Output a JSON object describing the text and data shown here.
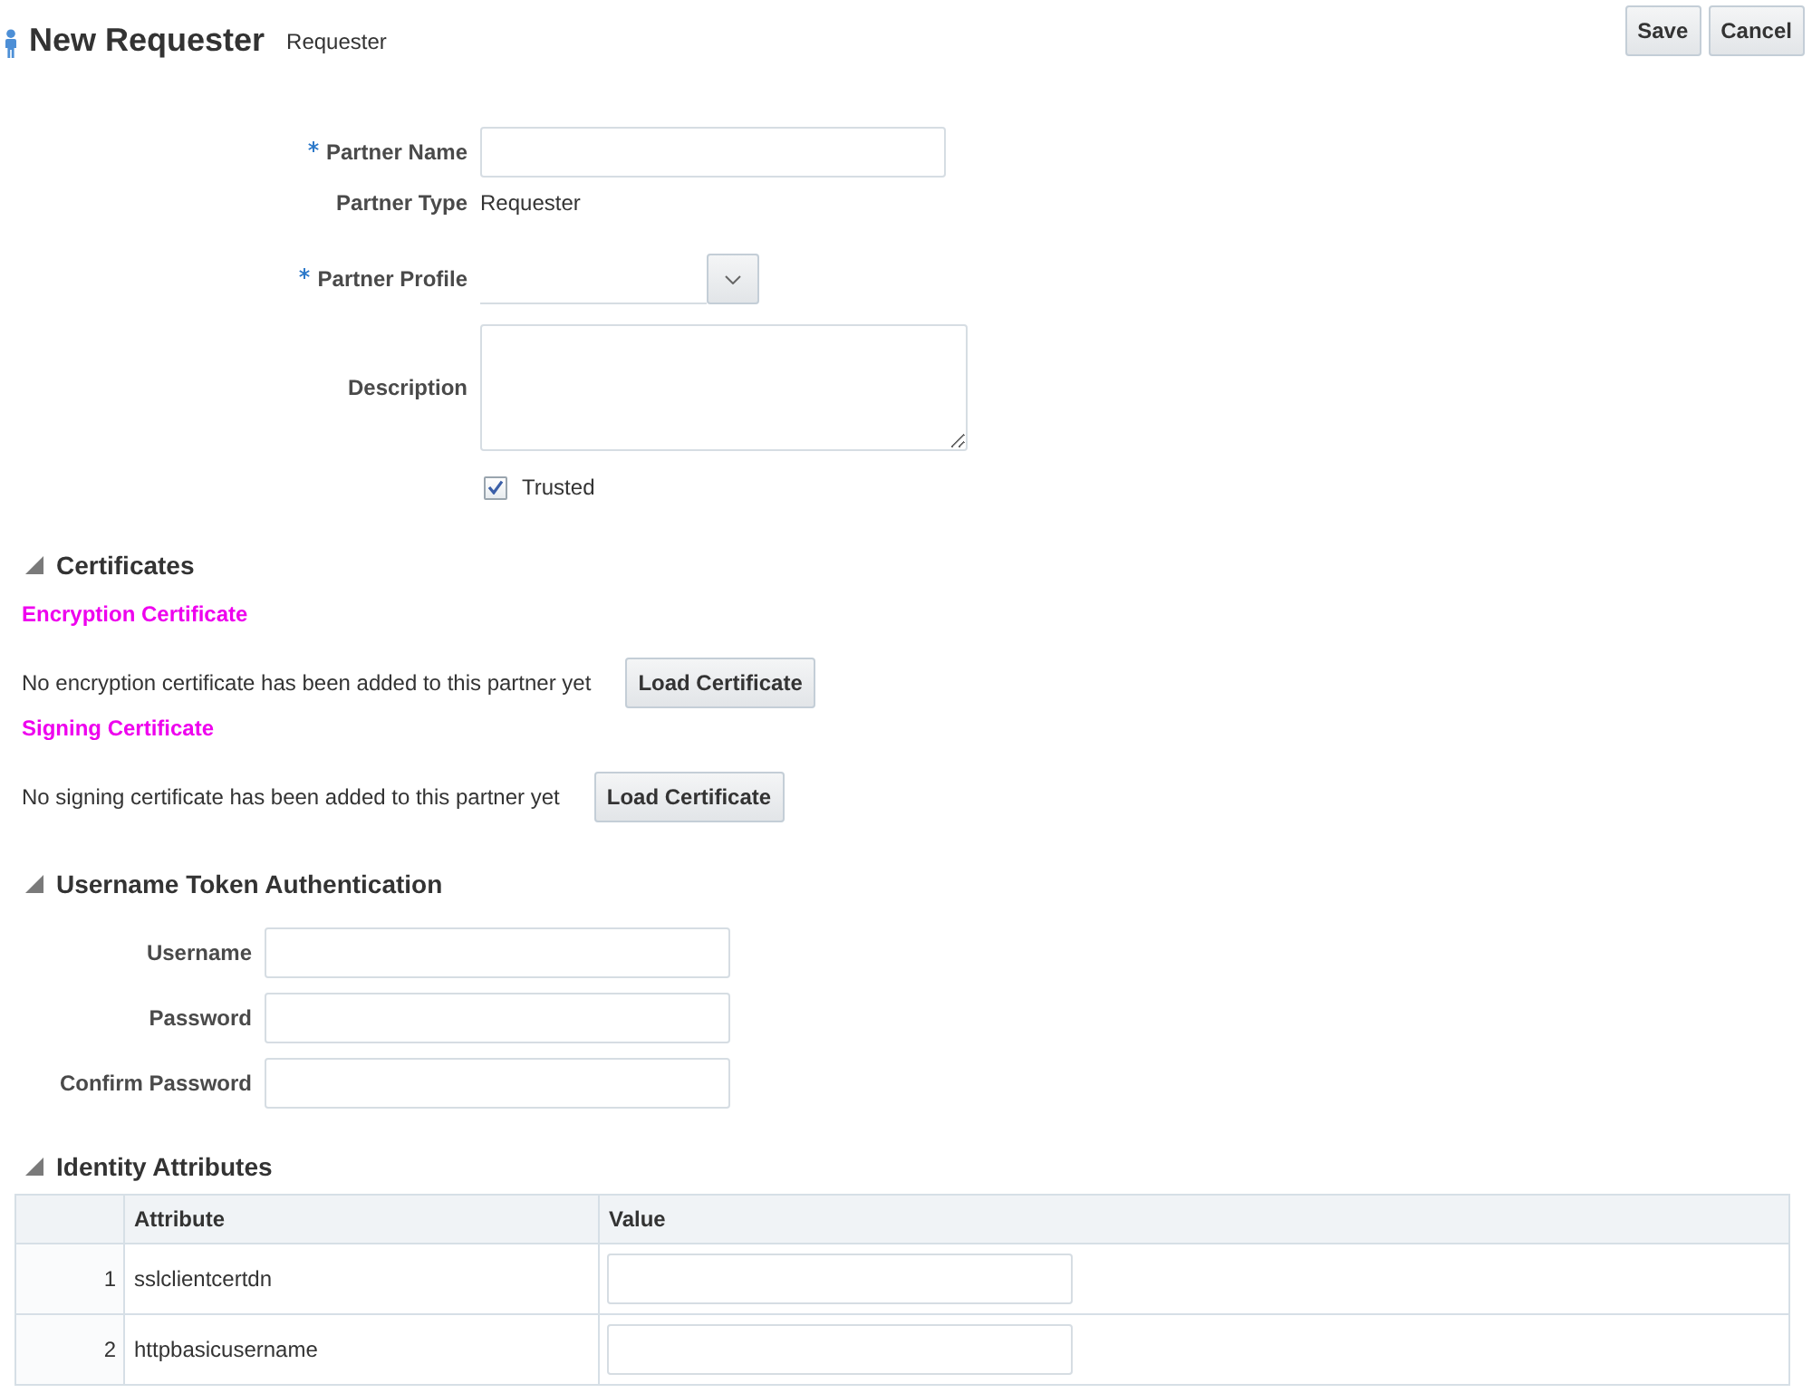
{
  "header": {
    "title": "New Requester",
    "subtitle": "Requester",
    "actions": [
      "Save",
      "Cancel"
    ]
  },
  "general": {
    "fields": [
      {
        "kind": "text",
        "label": "Partner Name",
        "required": true
      },
      {
        "kind": "static",
        "label": "Partner Type",
        "value": "Requester",
        "required": false
      },
      {
        "kind": "select",
        "label": "Partner Profile",
        "required": true
      },
      {
        "kind": "textarea",
        "label": "Description",
        "required": false
      }
    ],
    "trusted": {
      "label": "Trusted",
      "checked": true
    }
  },
  "sections": [
    {
      "kind": "certificates",
      "title": "Certificates",
      "expanded": true,
      "certificates": [
        {
          "title": "Encryption Certificate",
          "message": "No encryption certificate has been added to this partner yet",
          "button": "Load Certificate"
        },
        {
          "title": "Signing Certificate",
          "message": "No signing certificate has been added to this partner yet",
          "button": "Load Certificate"
        }
      ]
    },
    {
      "kind": "form",
      "title": "Username Token Authentication",
      "expanded": true,
      "fields": [
        {
          "label": "Username"
        },
        {
          "label": "Password"
        },
        {
          "label": "Confirm Password"
        }
      ]
    },
    {
      "kind": "table",
      "title": "Identity Attributes",
      "expanded": true,
      "table": {
        "columns": [
          "Attribute",
          "Value"
        ],
        "rows": [
          {
            "index": "1",
            "attribute": "sslclientcertdn"
          },
          {
            "index": "2",
            "attribute": "httpbasicusername"
          }
        ]
      }
    }
  ]
}
